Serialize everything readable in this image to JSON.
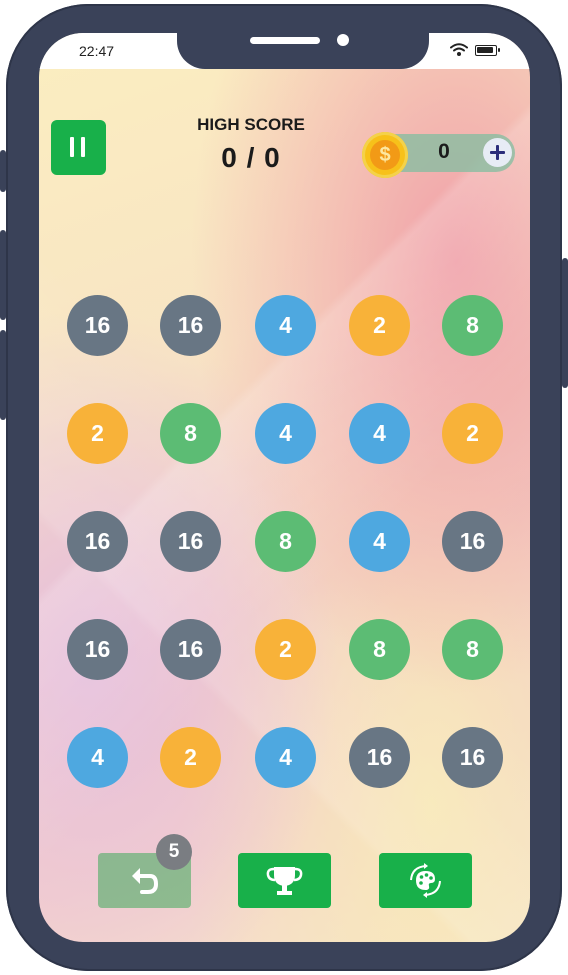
{
  "status_bar": {
    "time": "22:47"
  },
  "header": {
    "high_score_label": "HIGH SCORE",
    "score_text": "0 / 0",
    "coins": "0",
    "coin_symbol": "$"
  },
  "board": {
    "rows": [
      [
        "16",
        "16",
        "4",
        "2",
        "8"
      ],
      [
        "2",
        "8",
        "4",
        "4",
        "2"
      ],
      [
        "16",
        "16",
        "8",
        "4",
        "16"
      ],
      [
        "16",
        "16",
        "2",
        "8",
        "8"
      ],
      [
        "4",
        "2",
        "4",
        "16",
        "16"
      ]
    ]
  },
  "bottom_bar": {
    "undo_count": "5",
    "buttons": [
      {
        "name": "undo-button",
        "icon": "undo-arrow-icon"
      },
      {
        "name": "leaderboard-button",
        "icon": "trophy-icon"
      },
      {
        "name": "theme-button",
        "icon": "palette-icon"
      }
    ]
  },
  "colors": {
    "primary_green": "#18b04a",
    "tile_2": "#f8b239",
    "tile_4": "#4ea8e0",
    "tile_8": "#5cbc74",
    "tile_16": "#687684",
    "phone_frame": "#3a4259"
  }
}
